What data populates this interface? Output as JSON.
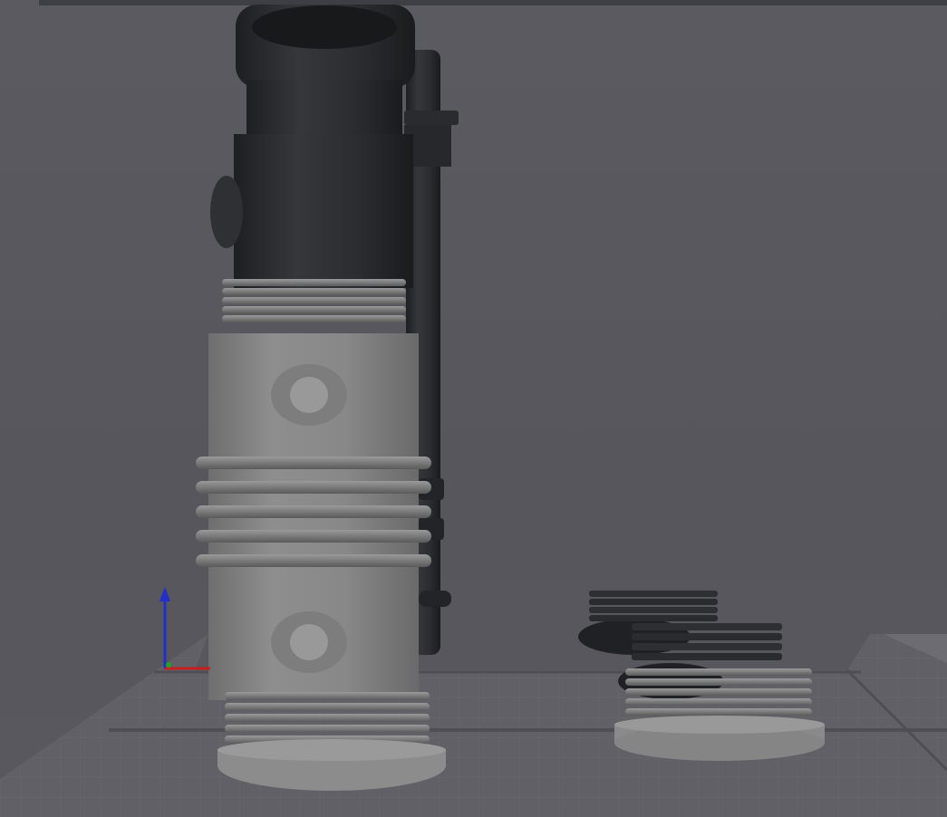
{
  "viewport": {
    "background": "#57575d",
    "top_bar_color": "#3e3f45"
  },
  "scene": {
    "objects": [
      "dark-tube",
      "dark-rod",
      "grey-threaded-tube",
      "dark-threaded-caps",
      "grey-threaded-cap"
    ],
    "palette": {
      "dark_part": "#2c2d30",
      "grey_part": "#8a8a8a",
      "build_plate": "#64646a"
    }
  },
  "axis_gizmo": {
    "icon": "axis-gizmo-icon",
    "colors": {
      "x": "#c81e1e",
      "y": "#1ea81e",
      "z": "#2030c8"
    }
  }
}
